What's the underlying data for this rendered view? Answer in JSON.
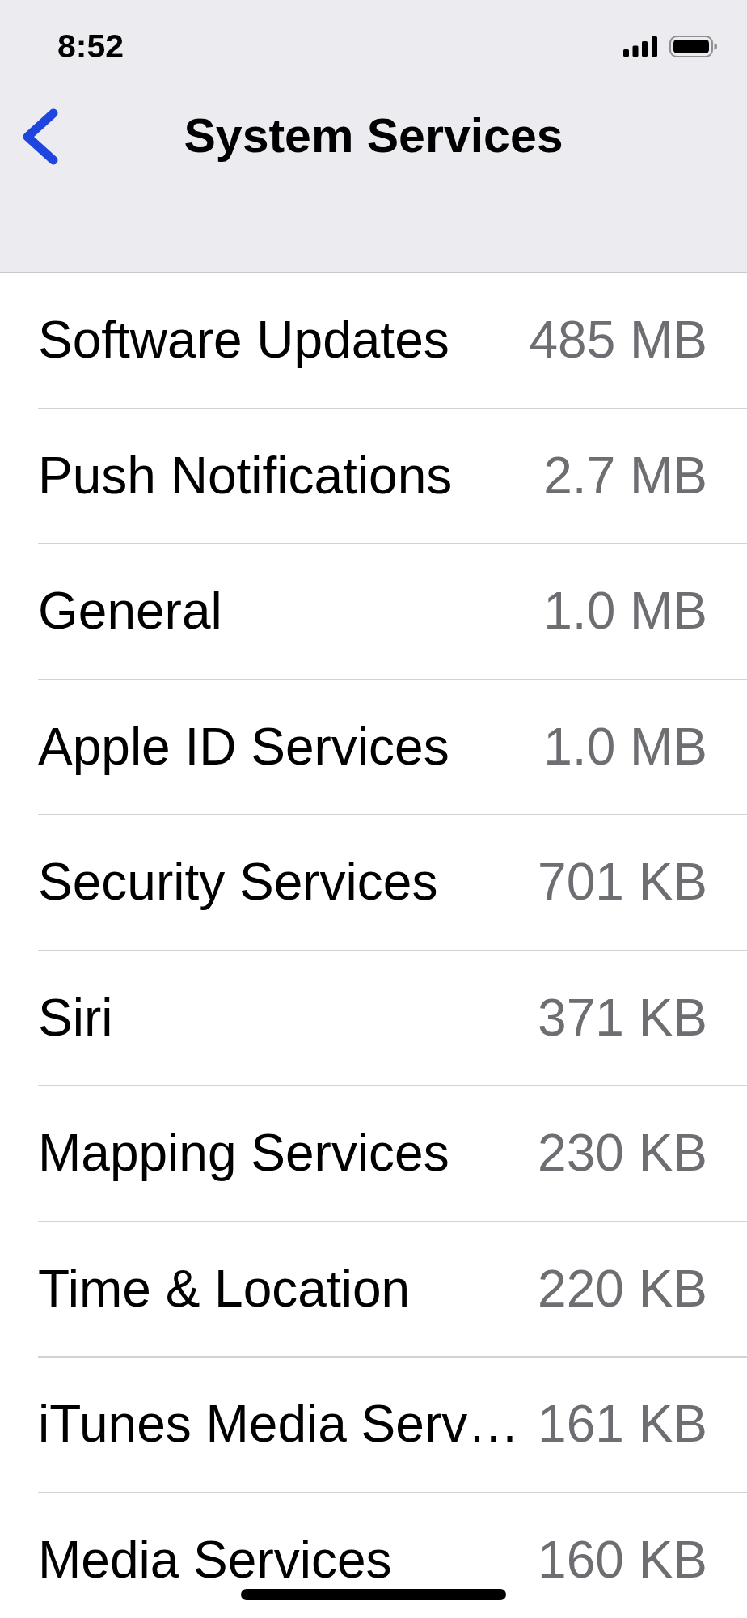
{
  "status_bar": {
    "time": "8:52"
  },
  "nav_bar": {
    "title": "System Services"
  },
  "services": [
    {
      "name": "Software Updates",
      "usage": "485 MB"
    },
    {
      "name": "Push Notifications",
      "usage": "2.7 MB"
    },
    {
      "name": "General",
      "usage": "1.0 MB"
    },
    {
      "name": "Apple ID Services",
      "usage": "1.0 MB"
    },
    {
      "name": "Security Services",
      "usage": "701 KB"
    },
    {
      "name": "Siri",
      "usage": "371 KB"
    },
    {
      "name": "Mapping Services",
      "usage": "230 KB"
    },
    {
      "name": "Time & Location",
      "usage": "220 KB"
    },
    {
      "name": "iTunes Media Serv…",
      "usage": "161 KB"
    },
    {
      "name": "Media Services",
      "usage": "160 KB"
    }
  ]
}
